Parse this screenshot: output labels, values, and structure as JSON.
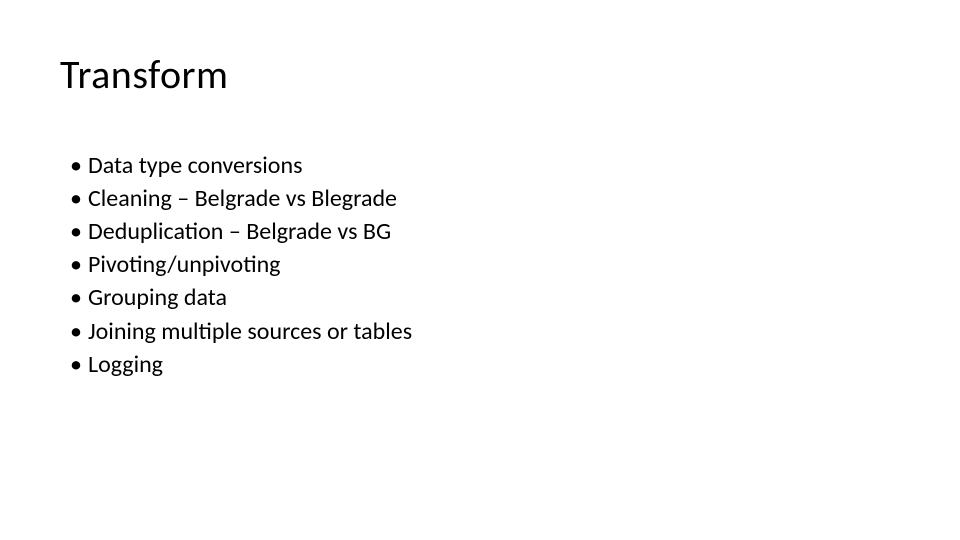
{
  "slide": {
    "title": "Transform",
    "bullets": [
      "Data type conversions",
      "Cleaning – Belgrade vs Blegrade",
      "Deduplication – Belgrade vs BG",
      "Pivoting/unpivoting",
      "Grouping data",
      "Joining multiple sources or tables",
      "Logging"
    ]
  }
}
